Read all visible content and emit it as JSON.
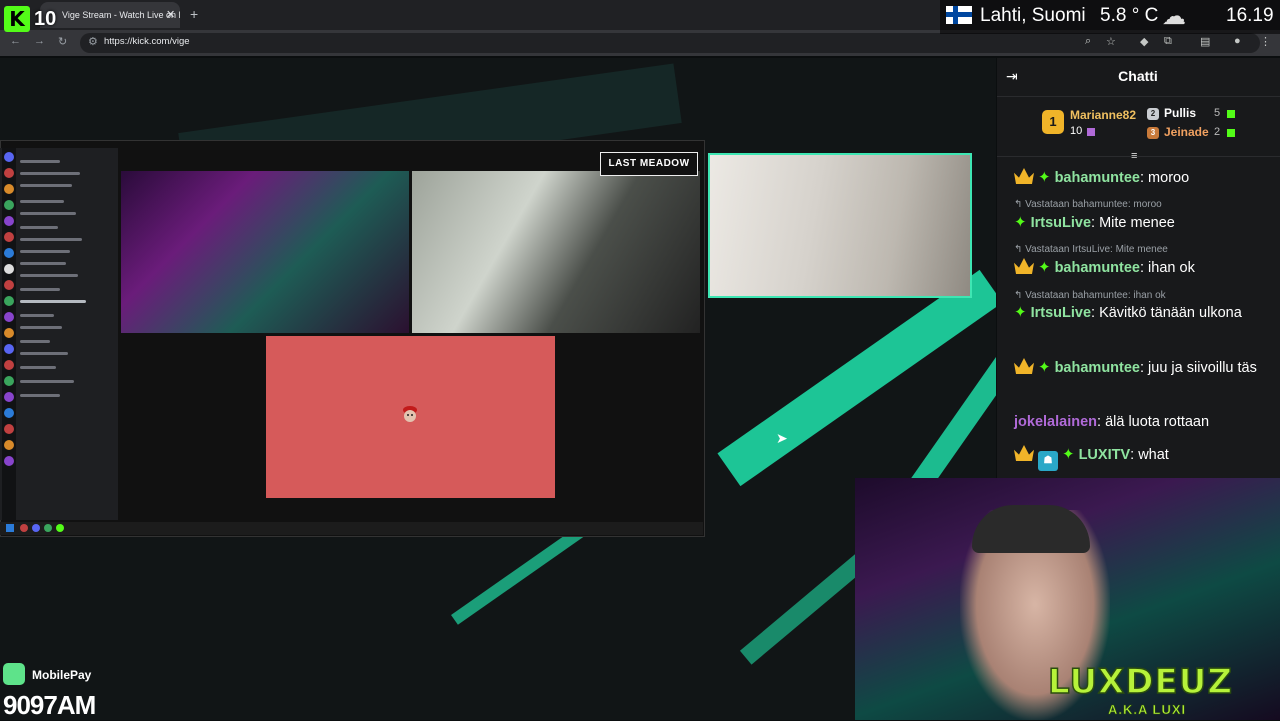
{
  "browser": {
    "tab_title": "Vige Stream - Watch Live on Ki",
    "tab_close": "✕",
    "new_tab": "+",
    "url": "https://kick.com/vige"
  },
  "overlay": {
    "kick_logo": "K",
    "kick_count": "10",
    "weather": {
      "location": "Lahti, Suomi",
      "temperature": "5.8 ° C",
      "time": "16.19",
      "icon": "cloud-icon"
    },
    "mobilepay": {
      "label": "MobilePay",
      "code": "9097AM"
    },
    "streamer_logo": "LUXDEUZ",
    "streamer_sub": "A.K.A LUXI"
  },
  "stage": {
    "game_badge": "LAST MEADOW"
  },
  "chat": {
    "title": "Chatti",
    "leaderboard": {
      "first": {
        "rank": "1",
        "name": "Marianne82",
        "value": "10"
      },
      "second": {
        "name": "Pullis",
        "value": "5"
      },
      "third": {
        "name": "Jeinade",
        "value": "2"
      }
    },
    "messages": [
      {
        "user": "bahamuntee",
        "text": ": moroo"
      },
      {
        "reply": "Vastataan bahamuntee: moroo",
        "user": "IrtsuLive",
        "text": ": Mite menee"
      },
      {
        "reply": "Vastataan IrtsuLive: Mite menee",
        "user": "bahamuntee",
        "text": ": ihan ok"
      },
      {
        "reply": "Vastataan bahamuntee: ihan ok",
        "user": "IrtsuLive",
        "text": ": Kävitkö tänään ulkona"
      },
      {
        "user": "bahamuntee",
        "text": ": juu ja siivoillu täs"
      },
      {
        "user": "jokelalainen",
        "text": ": älä luota rottaan"
      },
      {
        "user": "LUXITV",
        "text": ": what"
      }
    ]
  },
  "colors": {
    "kick_green": "#53fc18",
    "accent_teal": "#1fd8a4",
    "gold": "#f0b429",
    "user_green": "#8fe3a0",
    "user_purple": "#b06ad8"
  }
}
